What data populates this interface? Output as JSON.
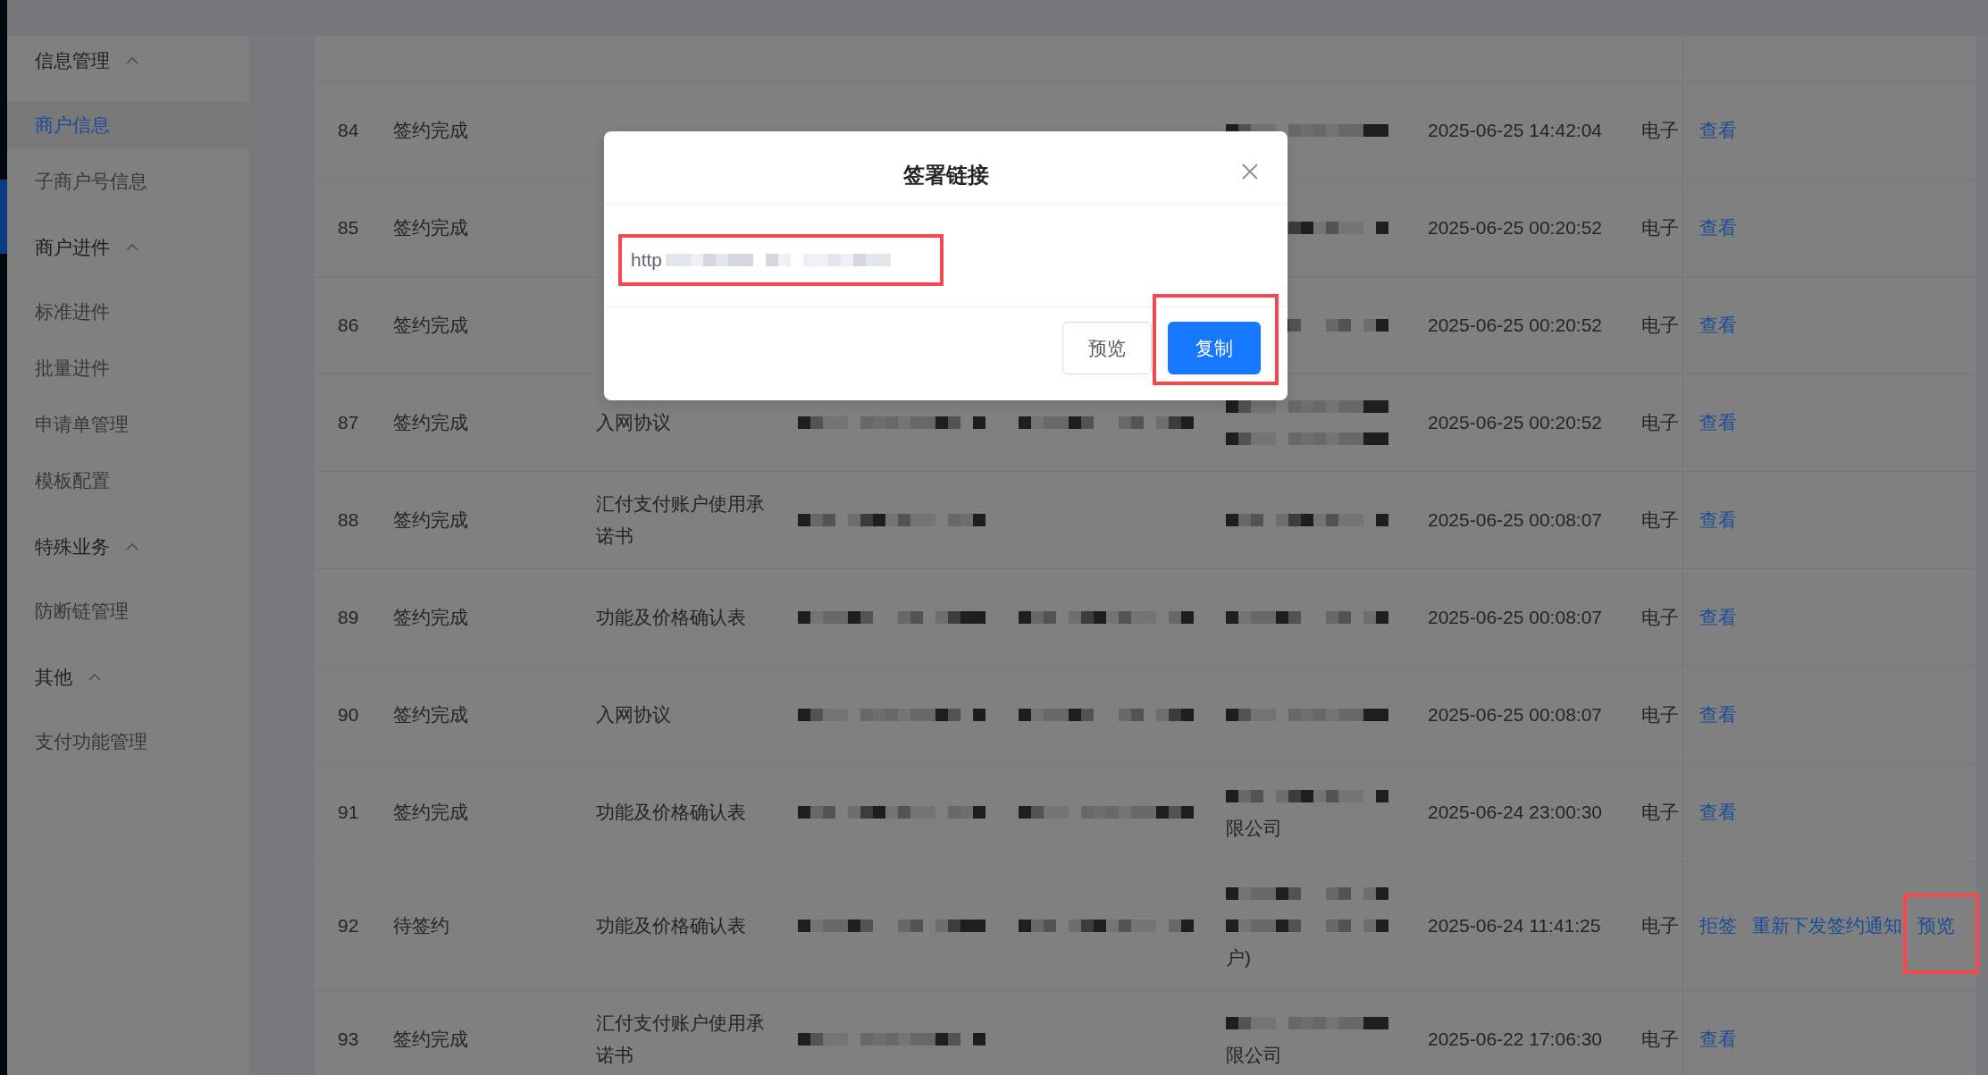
{
  "sidebar": {
    "groups": [
      {
        "label": "信息管理",
        "expanded": true,
        "children": [
          {
            "label": "商户信息",
            "selected": true
          },
          {
            "label": "子商户号信息",
            "selected": false
          }
        ]
      },
      {
        "label": "商户进件",
        "expanded": true,
        "children": [
          {
            "label": "标准进件",
            "selected": false
          },
          {
            "label": "批量进件",
            "selected": false
          },
          {
            "label": "申请单管理",
            "selected": false
          },
          {
            "label": "模板配置",
            "selected": false
          }
        ]
      },
      {
        "label": "特殊业务",
        "expanded": true,
        "children": [
          {
            "label": "防断链管理",
            "selected": false
          }
        ]
      },
      {
        "label": "其他",
        "expanded": true,
        "children": [
          {
            "label": "支付功能管理",
            "selected": false
          }
        ]
      }
    ]
  },
  "table": {
    "rows": [
      {
        "column_1": "84",
        "column_2": "签约完成",
        "column_6": [
          {
            "kind": "redacted"
          }
        ],
        "column_7": "2025-06-25 14:42:04",
        "column_8": "电子",
        "actions": [
          {
            "label": "查看",
            "highlighted": false
          }
        ]
      },
      {
        "column_1": "85",
        "column_2": "签约完成",
        "column_6": [
          {
            "kind": "redacted"
          }
        ],
        "column_7": "2025-06-25 00:20:52",
        "column_8": "电子",
        "actions": [
          {
            "label": "查看",
            "highlighted": false
          }
        ]
      },
      {
        "column_1": "86",
        "column_2": "签约完成",
        "column_6": [
          {
            "kind": "redacted"
          }
        ],
        "column_7": "2025-06-25 00:20:52",
        "column_8": "电子",
        "actions": [
          {
            "label": "查看",
            "highlighted": false
          }
        ]
      },
      {
        "column_1": "87",
        "column_2": "签约完成",
        "column_3": "入网协议",
        "column_4": [
          {
            "kind": "redacted"
          }
        ],
        "column_5": [
          {
            "kind": "redacted"
          }
        ],
        "column_6": [
          {
            "kind": "redacted"
          },
          {
            "kind": "redacted"
          }
        ],
        "column_7": "2025-06-25 00:20:52",
        "column_8": "电子",
        "actions": [
          {
            "label": "查看",
            "highlighted": false
          }
        ]
      },
      {
        "column_1": "88",
        "column_2": "签约完成",
        "column_3": "汇付支付账户使用承诺书",
        "column_4": [
          {
            "kind": "redacted"
          }
        ],
        "column_6": [
          {
            "kind": "redacted"
          }
        ],
        "column_7": "2025-06-25 00:08:07",
        "column_8": "电子",
        "actions": [
          {
            "label": "查看",
            "highlighted": false
          }
        ]
      },
      {
        "column_1": "89",
        "column_2": "签约完成",
        "column_3": "功能及价格确认表",
        "column_4": [
          {
            "kind": "redacted"
          }
        ],
        "column_5": [
          {
            "kind": "redacted"
          }
        ],
        "column_6": [
          {
            "kind": "redacted"
          }
        ],
        "column_7": "2025-06-25 00:08:07",
        "column_8": "电子",
        "actions": [
          {
            "label": "查看",
            "highlighted": false
          }
        ]
      },
      {
        "column_1": "90",
        "column_2": "签约完成",
        "column_3": "入网协议",
        "column_4": [
          {
            "kind": "redacted"
          }
        ],
        "column_5": [
          {
            "kind": "redacted"
          }
        ],
        "column_6": [
          {
            "kind": "redacted"
          }
        ],
        "column_7": "2025-06-25 00:08:07",
        "column_8": "电子",
        "actions": [
          {
            "label": "查看",
            "highlighted": false
          }
        ]
      },
      {
        "column_1": "91",
        "column_2": "签约完成",
        "column_3": "功能及价格确认表",
        "column_4": [
          {
            "kind": "redacted"
          }
        ],
        "column_5": [
          {
            "kind": "redacted"
          }
        ],
        "column_6": [
          {
            "kind": "redacted"
          },
          {
            "kind": "text",
            "text": "限公司"
          }
        ],
        "column_7": "2025-06-24 23:00:30",
        "column_8": "电子",
        "actions": [
          {
            "label": "查看",
            "highlighted": false
          }
        ]
      },
      {
        "column_1": "92",
        "column_2": "待签约",
        "column_3": "功能及价格确认表",
        "column_4": [
          {
            "kind": "redacted"
          }
        ],
        "column_5": [
          {
            "kind": "redacted"
          }
        ],
        "column_6": [
          {
            "kind": "redacted"
          },
          {
            "kind": "redacted"
          },
          {
            "kind": "text",
            "text": "户)"
          }
        ],
        "column_7": "2025-06-24 11:41:25",
        "column_8": "电子",
        "actions": [
          {
            "label": "拒签",
            "highlighted": false
          },
          {
            "label": "重新下发签约通知",
            "highlighted": false
          },
          {
            "label": "预览",
            "highlighted": true
          }
        ]
      },
      {
        "column_1": "93",
        "column_2": "签约完成",
        "column_3": "汇付支付账户使用承诺书",
        "column_4": [
          {
            "kind": "redacted"
          }
        ],
        "column_6": [
          {
            "kind": "redacted"
          },
          {
            "kind": "text",
            "text": "限公司"
          }
        ],
        "column_7": "2025-06-22 17:06:30",
        "column_8": "电子",
        "actions": [
          {
            "label": "查看",
            "highlighted": false
          }
        ]
      }
    ]
  },
  "dialog": {
    "title": "签署链接",
    "link_field": {
      "value": "http",
      "redacted": true,
      "highlighted": true
    },
    "buttons": [
      {
        "label": "预览",
        "kind": "default",
        "highlighted": false
      },
      {
        "label": "复制",
        "kind": "primary",
        "highlighted": true
      }
    ]
  }
}
